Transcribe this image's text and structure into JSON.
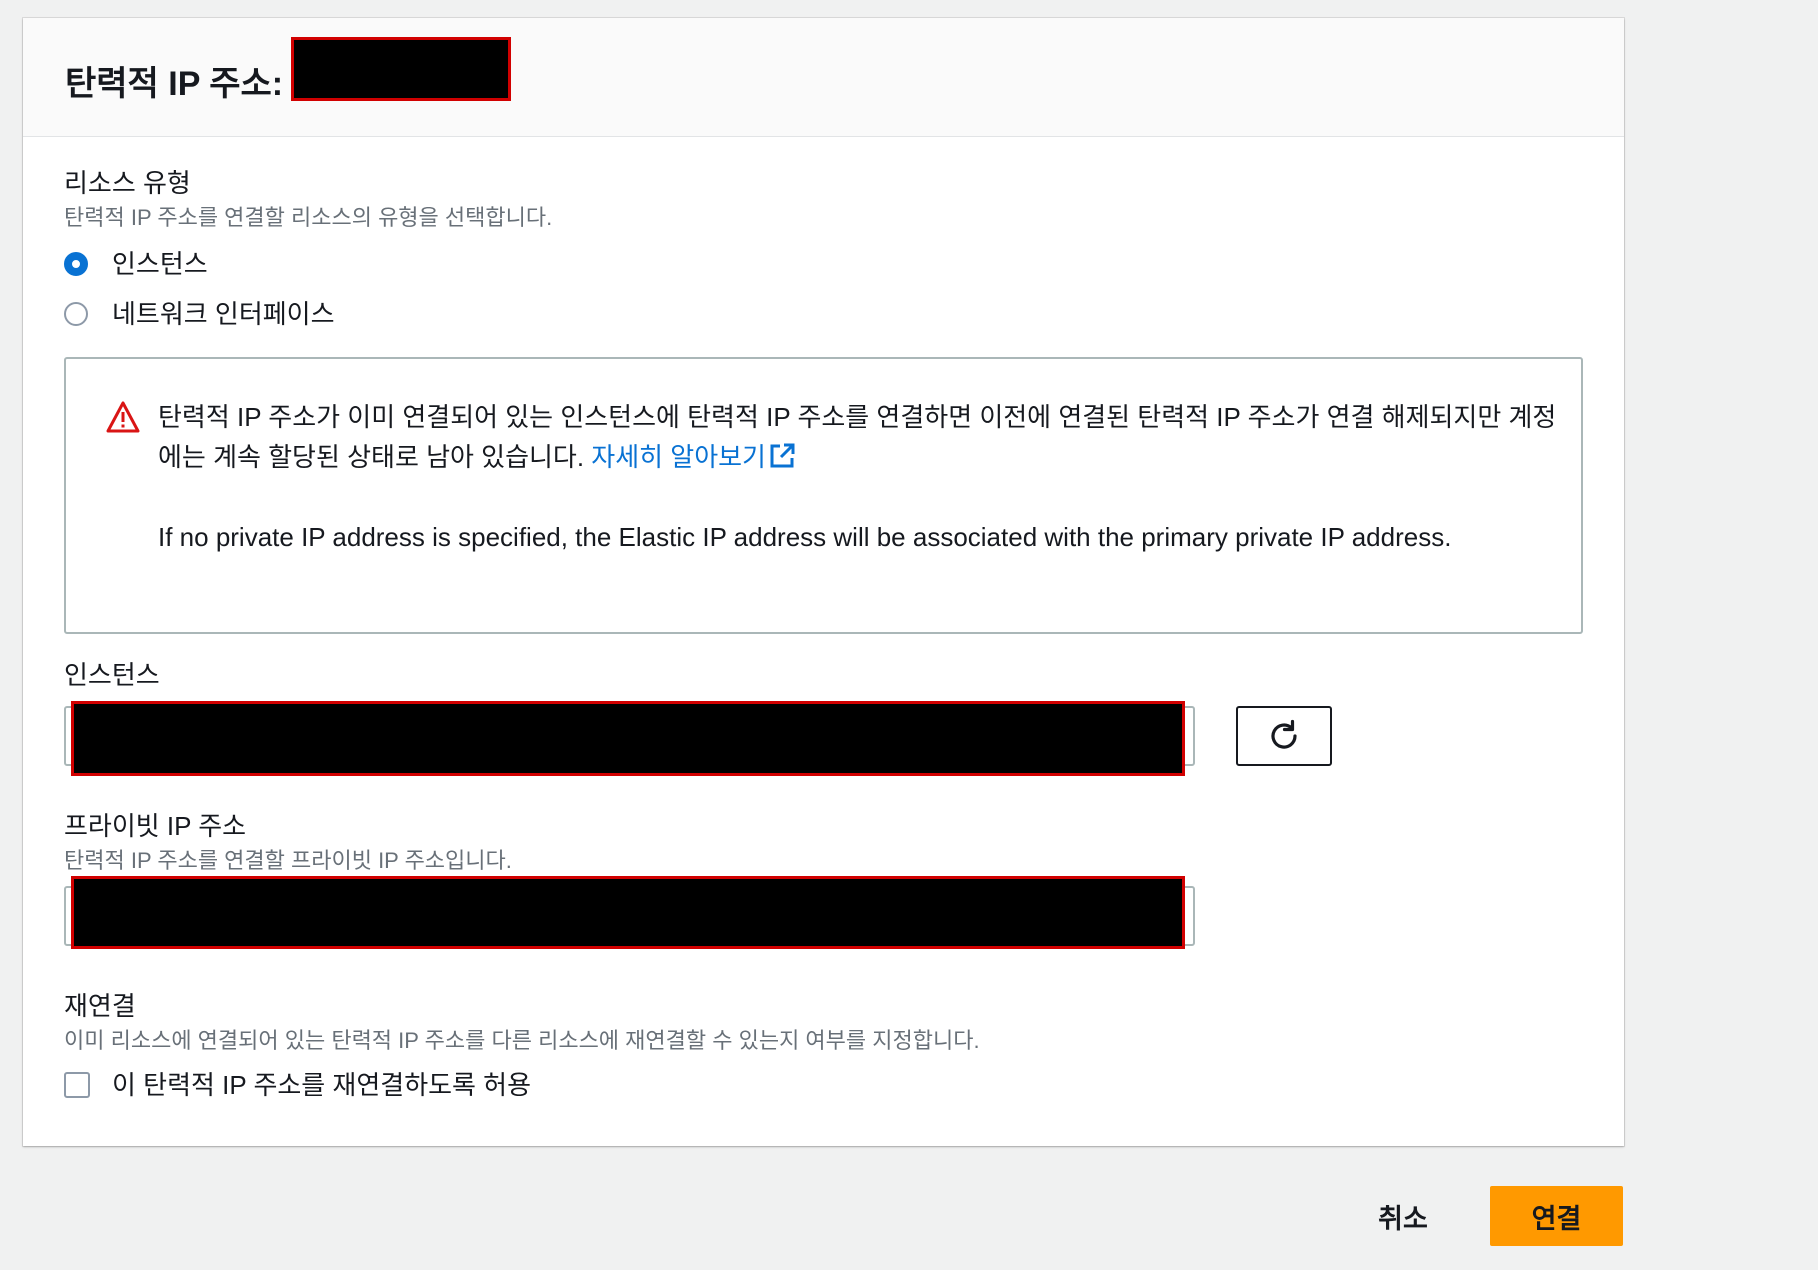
{
  "header": {
    "title": "탄력적 IP 주소:"
  },
  "resource_type": {
    "label": "리소스 유형",
    "description": "탄력적 IP 주소를 연결할 리소스의 유형을 선택합니다.",
    "options": [
      {
        "label": "인스턴스",
        "checked": true
      },
      {
        "label": "네트워크 인터페이스",
        "checked": false
      }
    ]
  },
  "alert": {
    "type": "warning",
    "icon": "warning-triangle-icon",
    "text_1": "탄력적 IP 주소가 이미 연결되어 있는 인스턴스에 탄력적 IP 주소를 연결하면 이전에 연결된 탄력적 IP 주소가 연결 해제되지만 계정에는 계속 할당된 상태로 남아 있습니다. ",
    "link_label": "자세히 알아보기",
    "text_2": "If no private IP address is specified, the Elastic IP address will be associated with the primary private IP address."
  },
  "instance": {
    "label": "인스턴스",
    "value": "",
    "refresh_icon": "refresh-icon"
  },
  "private_ip": {
    "label": "프라이빗 IP 주소",
    "description": "탄력적 IP 주소를 연결할 프라이빗 IP 주소입니다.",
    "value": ""
  },
  "reassociate": {
    "label": "재연결",
    "description": "이미 리소스에 연결되어 있는 탄력적 IP 주소를 다른 리소스에 재연결할 수 있는지 여부를 지정합니다.",
    "checkbox_label": "이 탄력적 IP 주소를 재연결하도록 허용",
    "checked": false
  },
  "footer": {
    "cancel_label": "취소",
    "submit_label": "연결"
  },
  "colors": {
    "accent": "#0972d3",
    "primary_button": "#ff9900",
    "warning": "#d91515",
    "redaction_border": "#d10000"
  }
}
